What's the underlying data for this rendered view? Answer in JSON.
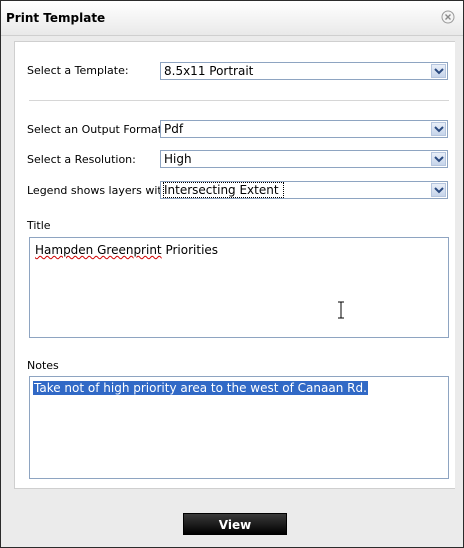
{
  "dialog": {
    "title": "Print Template"
  },
  "form": {
    "template_label": "Select a Template:",
    "template_value": "8.5x11 Portrait",
    "format_label": "Select an Output Format:",
    "format_value": "Pdf",
    "resolution_label": "Select a Resolution:",
    "resolution_value": "High",
    "legend_label": "Legend shows layers with:",
    "legend_value": "Intersecting Extent",
    "title_label": "Title",
    "title_value_part1": "Hampden Greenprint",
    "title_value_part2": " Priorities",
    "notes_label": "Notes",
    "notes_value": "Take not of high priority area to the west of Canaan Rd."
  },
  "footer": {
    "view_label": "View"
  },
  "icons": {
    "close": "close-icon",
    "dropdown": "chevron-down-icon",
    "cursor": "text-cursor-icon"
  },
  "colors": {
    "selection": "#3169c6",
    "field_border": "#8ea4c1",
    "button_bg": "#000000"
  }
}
